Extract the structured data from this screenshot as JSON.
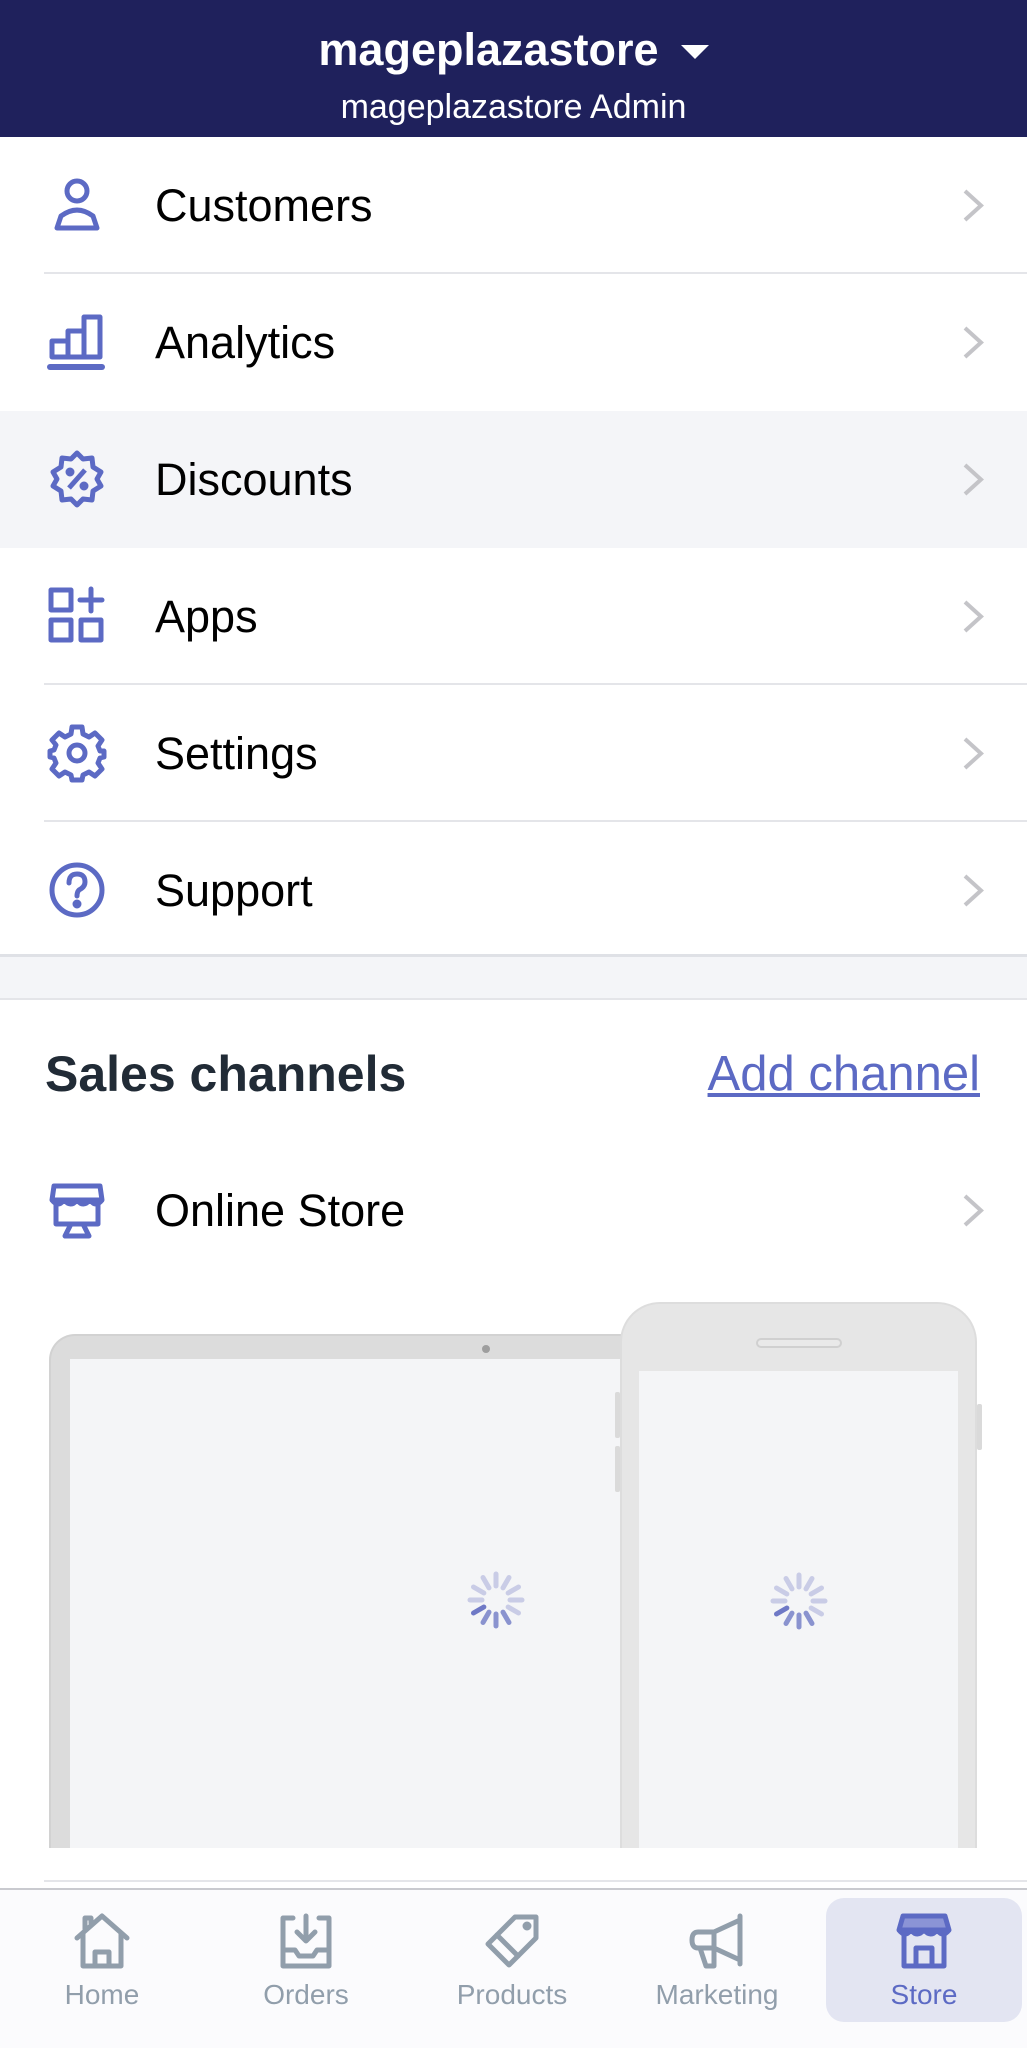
{
  "header": {
    "store_name": "mageplazastore",
    "subtitle": "mageplazastore Admin",
    "dropdown_icon": "caret-down-icon"
  },
  "colors": {
    "header_bg": "#1f215c",
    "accent": "#5c6ac4",
    "tab_inactive": "#919eab",
    "heading": "#212b36"
  },
  "menu": {
    "items": [
      {
        "label": "Customers",
        "icon": "customer-icon",
        "highlighted": false
      },
      {
        "label": "Analytics",
        "icon": "analytics-icon",
        "highlighted": false
      },
      {
        "label": "Discounts",
        "icon": "discount-icon",
        "highlighted": true
      },
      {
        "label": "Apps",
        "icon": "apps-icon",
        "highlighted": false
      },
      {
        "label": "Settings",
        "icon": "gear-icon",
        "highlighted": false
      },
      {
        "label": "Support",
        "icon": "help-icon",
        "highlighted": false
      }
    ]
  },
  "sales_channels": {
    "heading": "Sales channels",
    "add_link": "Add channel",
    "channels": [
      {
        "label": "Online Store",
        "icon": "store-icon"
      }
    ],
    "preview_state": "loading"
  },
  "tabbar": {
    "tabs": [
      {
        "label": "Home",
        "icon": "home-icon",
        "active": false
      },
      {
        "label": "Orders",
        "icon": "orders-icon",
        "active": false
      },
      {
        "label": "Products",
        "icon": "tag-icon",
        "active": false
      },
      {
        "label": "Marketing",
        "icon": "megaphone-icon",
        "active": false
      },
      {
        "label": "Store",
        "icon": "store-icon",
        "active": true
      }
    ]
  }
}
